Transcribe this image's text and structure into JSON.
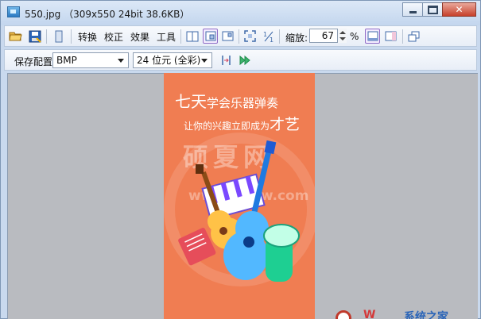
{
  "window": {
    "title": "550.jpg （309x550  24bit  38.6KB）",
    "controls": {
      "close": "✕"
    }
  },
  "toolbar": {
    "menus": [
      "转换",
      "校正",
      "效果",
      "工具"
    ],
    "zoom_label": "缩放:",
    "zoom_value": "67",
    "zoom_unit": "%"
  },
  "save_bar": {
    "label": "保存配置",
    "format": "BMP",
    "color_depth": "24 位元 (全彩)"
  },
  "image": {
    "title_big": "七天",
    "title_small": "学会乐器弹奏",
    "subtitle_small": "让你的兴趣立即成为",
    "subtitle_big": "才艺",
    "background_color": "#f07d52",
    "watermark_text": "硕夏网",
    "watermark_url": "www.sxiaw.com"
  },
  "bottom_watermark": {
    "brand": "系统之家"
  }
}
